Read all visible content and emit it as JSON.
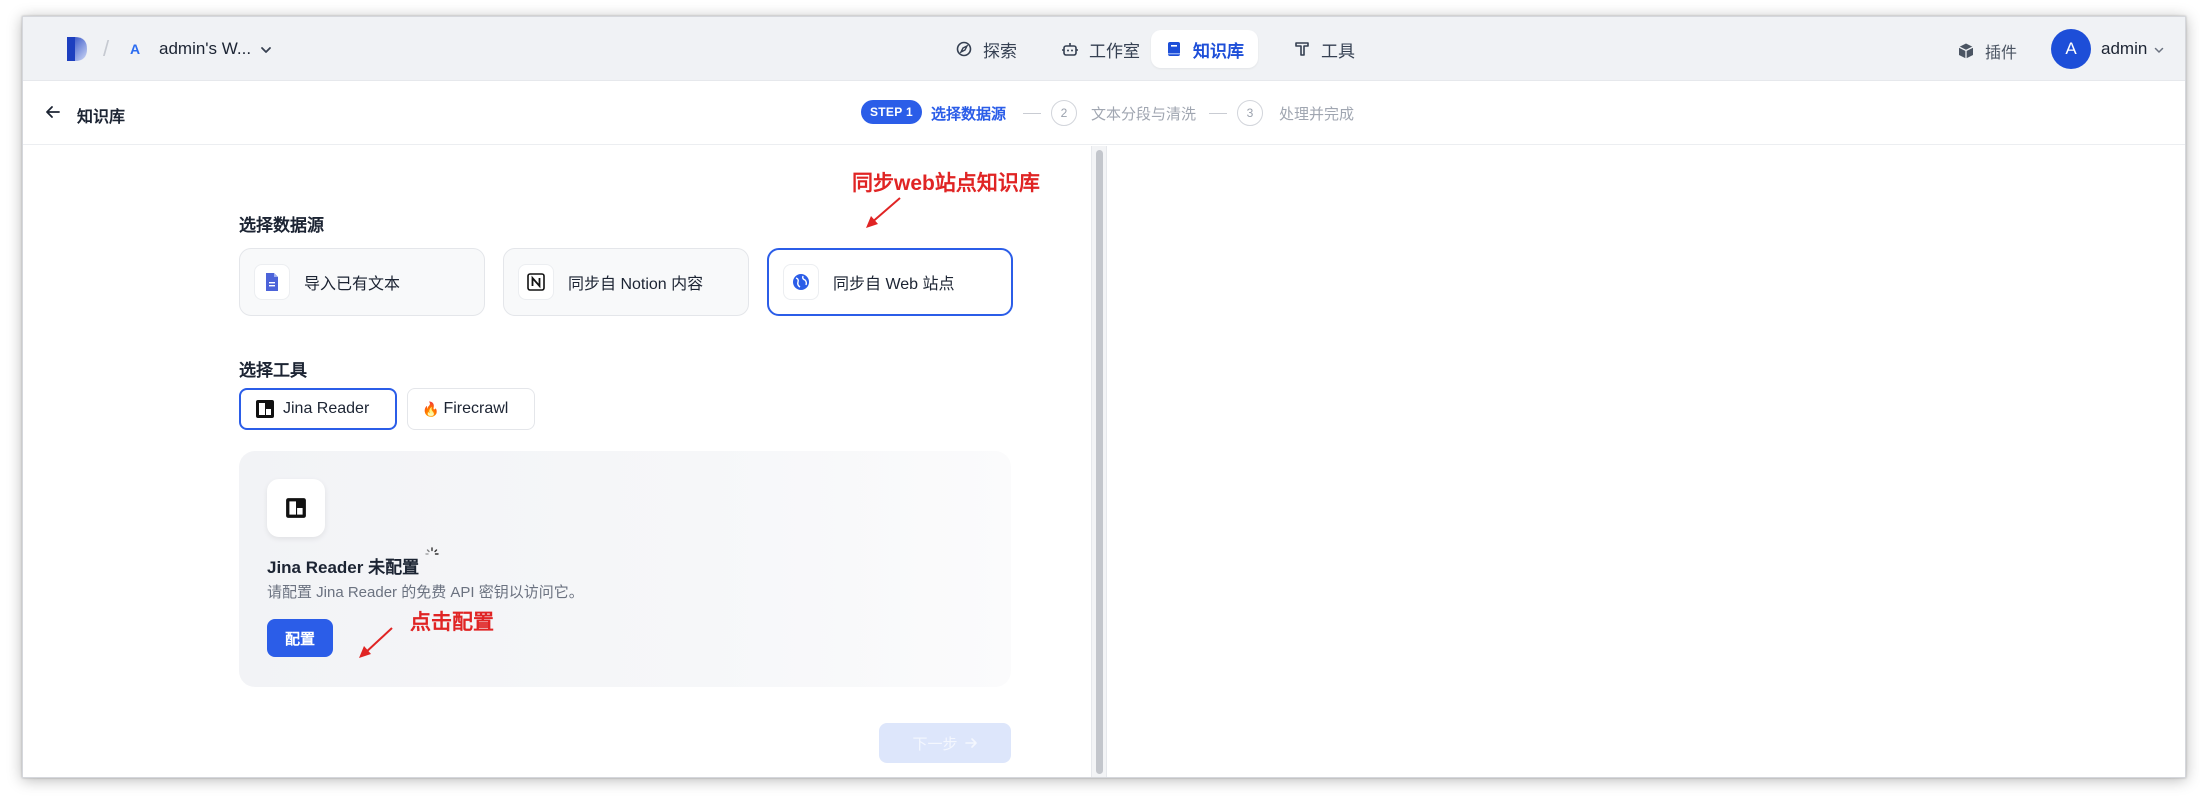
{
  "topnav": {
    "workspace_badge": "A",
    "workspace_name": "admin's W...",
    "tabs": [
      {
        "label": "探索",
        "icon": "compass-icon",
        "active": false
      },
      {
        "label": "工作室",
        "icon": "robot-icon",
        "active": false
      },
      {
        "label": "知识库",
        "icon": "book-icon",
        "active": true
      },
      {
        "label": "工具",
        "icon": "hammer-icon",
        "active": false
      }
    ],
    "plugin_label": "插件",
    "avatar_letter": "A",
    "user_name": "admin"
  },
  "stepbar": {
    "back_label": "知识库",
    "steps": [
      {
        "badge": "STEP 1",
        "label": "选择数据源",
        "state": "active"
      },
      {
        "badge": "2",
        "label": "文本分段与清洗",
        "state": "pending"
      },
      {
        "badge": "3",
        "label": "处理并完成",
        "state": "pending"
      }
    ]
  },
  "datasource": {
    "title": "选择数据源",
    "options": [
      {
        "label": "导入已有文本",
        "icon": "file-text-icon",
        "selected": false
      },
      {
        "label": "同步自 Notion 内容",
        "icon": "notion-icon",
        "selected": false
      },
      {
        "label": "同步自 Web 站点",
        "icon": "globe-icon",
        "selected": true
      }
    ]
  },
  "tools": {
    "title": "选择工具",
    "options": [
      {
        "label": "Jina Reader",
        "icon": "jina-icon",
        "selected": true
      },
      {
        "label": "Firecrawl",
        "icon": "fire-icon",
        "prefix": "🔥",
        "selected": false
      }
    ]
  },
  "config": {
    "title": "Jina Reader 未配置",
    "description": "请配置 Jina Reader 的免费 API 密钥以访问它。",
    "button_label": "配置"
  },
  "next_button": {
    "label": "下一步",
    "enabled": false
  },
  "annotations": {
    "web_sync": "同步web站点知识库",
    "click_config": "点击配置"
  },
  "colors": {
    "accent": "#2b5de8",
    "annotation": "#e02424",
    "nav_bg": "#f0f2f5"
  }
}
